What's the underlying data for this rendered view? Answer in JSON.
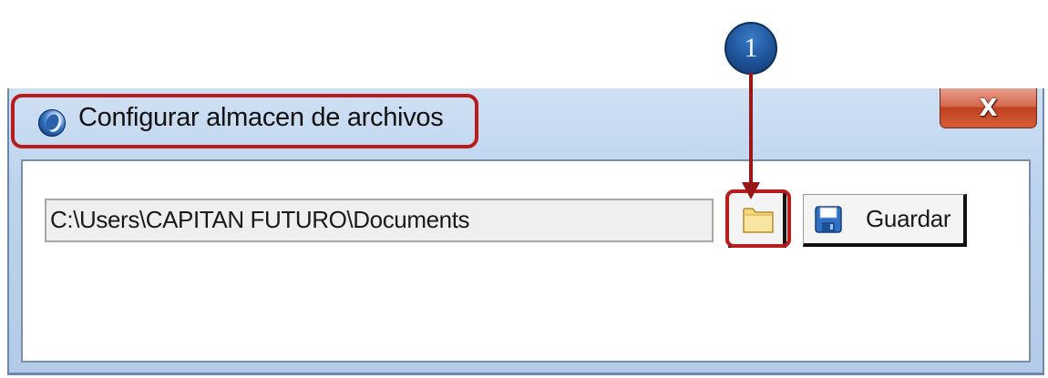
{
  "window": {
    "title": "Configurar almacen de archivos",
    "close_label": "X",
    "icon": "app-globe-icon"
  },
  "form": {
    "path_value": "C:\\Users\\CAPITAN FUTURO\\Documents",
    "browse_icon": "folder-icon",
    "save_icon": "floppy-disk-icon",
    "save_label": "Guardar"
  },
  "annotation": {
    "badge_number": "1",
    "highlight_color": "#b81c1c",
    "badge_color": "#1c4f93"
  }
}
